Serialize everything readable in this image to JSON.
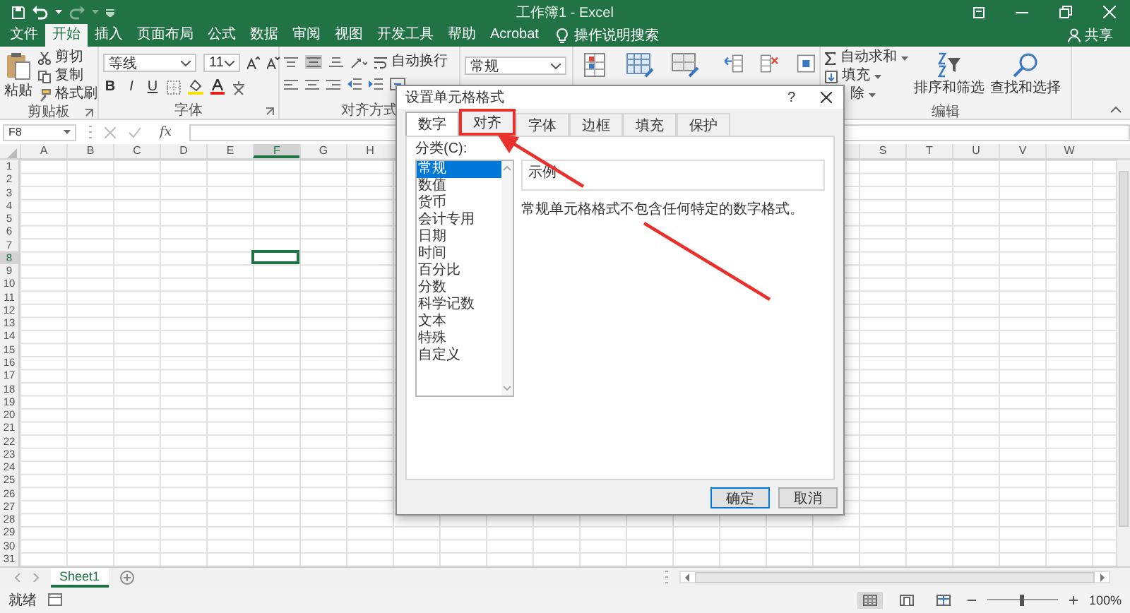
{
  "window": {
    "title": "工作簿1 - Excel"
  },
  "menu_tabs": [
    {
      "label": "文件",
      "selected": false
    },
    {
      "label": "开始",
      "selected": true
    },
    {
      "label": "插入",
      "selected": false
    },
    {
      "label": "页面布局",
      "selected": false
    },
    {
      "label": "公式",
      "selected": false
    },
    {
      "label": "数据",
      "selected": false
    },
    {
      "label": "审阅",
      "selected": false
    },
    {
      "label": "视图",
      "selected": false
    },
    {
      "label": "开发工具",
      "selected": false
    },
    {
      "label": "帮助",
      "selected": false
    },
    {
      "label": "Acrobat",
      "selected": false
    }
  ],
  "tell_me": {
    "placeholder": "操作说明搜索"
  },
  "share_button": "共享",
  "ribbon": {
    "clipboard": {
      "label": "剪贴板",
      "paste": "粘贴",
      "items": [
        "剪切",
        "复制",
        "格式刷"
      ]
    },
    "font": {
      "label": "字体",
      "font_name": "等线",
      "font_size": "11",
      "bold": "B",
      "italic": "I",
      "underline": "U"
    },
    "alignment": {
      "label": "对齐方式",
      "wrap_text": "自动换行"
    },
    "number": {
      "format": "常规"
    },
    "editing": {
      "label": "编辑",
      "autosum": "自动求和",
      "fill": "填充",
      "clear": "除",
      "sort_filter": "排序和筛选",
      "find_select": "查找和选择"
    }
  },
  "formula_bar": {
    "name_box": "F8",
    "fx": "fx"
  },
  "sheet": {
    "columns": [
      {
        "label": "A",
        "selected": false
      },
      {
        "label": "B",
        "selected": false
      },
      {
        "label": "C",
        "selected": false
      },
      {
        "label": "D",
        "selected": false
      },
      {
        "label": "E",
        "selected": false
      },
      {
        "label": "F",
        "selected": true
      },
      {
        "label": "G",
        "selected": false
      },
      {
        "label": "H",
        "selected": false
      },
      {
        "label": "S",
        "selected": false
      },
      {
        "label": "T",
        "selected": false
      },
      {
        "label": "U",
        "selected": false
      },
      {
        "label": "V",
        "selected": false
      },
      {
        "label": "W",
        "selected": false
      }
    ],
    "rows": [
      {
        "label": "1",
        "selected": false
      },
      {
        "label": "2",
        "selected": false
      },
      {
        "label": "3",
        "selected": false
      },
      {
        "label": "4",
        "selected": false
      },
      {
        "label": "5",
        "selected": false
      },
      {
        "label": "6",
        "selected": false
      },
      {
        "label": "7",
        "selected": false
      },
      {
        "label": "8",
        "selected": true
      },
      {
        "label": "9",
        "selected": false
      },
      {
        "label": "10",
        "selected": false
      },
      {
        "label": "11",
        "selected": false
      },
      {
        "label": "12",
        "selected": false
      },
      {
        "label": "13",
        "selected": false
      },
      {
        "label": "14",
        "selected": false
      },
      {
        "label": "15",
        "selected": false
      },
      {
        "label": "16",
        "selected": false
      },
      {
        "label": "17",
        "selected": false
      },
      {
        "label": "18",
        "selected": false
      },
      {
        "label": "19",
        "selected": false
      },
      {
        "label": "20",
        "selected": false
      },
      {
        "label": "21",
        "selected": false
      },
      {
        "label": "22",
        "selected": false
      },
      {
        "label": "23",
        "selected": false
      },
      {
        "label": "24",
        "selected": false
      },
      {
        "label": "25",
        "selected": false
      },
      {
        "label": "26",
        "selected": false
      },
      {
        "label": "27",
        "selected": false
      },
      {
        "label": "28",
        "selected": false
      },
      {
        "label": "29",
        "selected": false
      },
      {
        "label": "30",
        "selected": false
      },
      {
        "label": "31",
        "selected": false
      }
    ]
  },
  "sheet_tabs": [
    {
      "label": "Sheet1",
      "selected": true
    }
  ],
  "status_bar": {
    "text": "就绪",
    "views": [
      {
        "kind": "normal",
        "selected": true
      },
      {
        "kind": "page_layout",
        "selected": false
      },
      {
        "kind": "page_break",
        "selected": false
      }
    ],
    "zoom_slider": {
      "level": 0.5
    },
    "zoom": "100%"
  },
  "dialog": {
    "title": "设置单元格格式",
    "help": "?",
    "tabs": [
      {
        "label": "数字",
        "selected": true,
        "highlighted": false
      },
      {
        "label": "对齐",
        "selected": false,
        "highlighted": true
      },
      {
        "label": "字体",
        "selected": false,
        "highlighted": false
      },
      {
        "label": "边框",
        "selected": false,
        "highlighted": false
      },
      {
        "label": "填充",
        "selected": false,
        "highlighted": false
      },
      {
        "label": "保护",
        "selected": false,
        "highlighted": false
      }
    ],
    "category_label": "分类(C):",
    "categories": [
      {
        "label": "常规",
        "selected": true
      },
      {
        "label": "数值",
        "selected": false
      },
      {
        "label": "货币",
        "selected": false
      },
      {
        "label": "会计专用",
        "selected": false
      },
      {
        "label": "日期",
        "selected": false
      },
      {
        "label": "时间",
        "selected": false
      },
      {
        "label": "百分比",
        "selected": false
      },
      {
        "label": "分数",
        "selected": false
      },
      {
        "label": "科学记数",
        "selected": false
      },
      {
        "label": "文本",
        "selected": false
      },
      {
        "label": "特殊",
        "selected": false
      },
      {
        "label": "自定义",
        "selected": false
      }
    ],
    "sample_label": "示例",
    "description": "常规单元格格式不包含任何特定的数字格式。",
    "buttons": [
      {
        "label": "确定",
        "kind": "default"
      },
      {
        "label": "取消",
        "kind": "normal"
      }
    ]
  },
  "annotations": [
    {
      "kind": "arrow"
    }
  ]
}
